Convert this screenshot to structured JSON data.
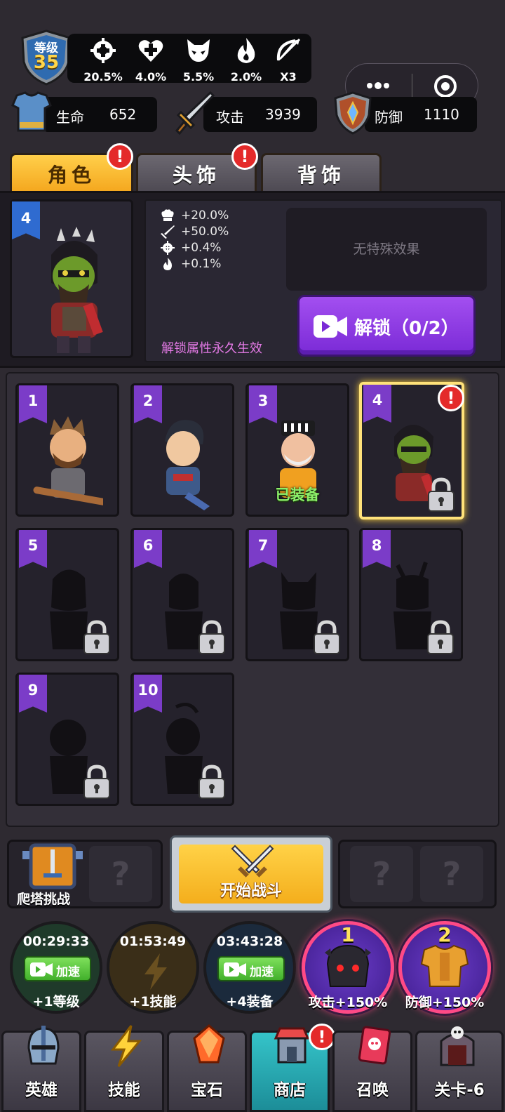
{
  "player": {
    "level_label": "等级",
    "level": "35"
  },
  "stats": [
    {
      "icon": "crosshair-icon",
      "value": "20.5%"
    },
    {
      "icon": "heart-plus-icon",
      "value": "4.0%"
    },
    {
      "icon": "beast-skull-icon",
      "value": "5.5%"
    },
    {
      "icon": "flame-icon",
      "value": "2.0%"
    },
    {
      "icon": "bow-icon",
      "value": "X3"
    }
  ],
  "resources": {
    "life_label": "生命",
    "life": "652",
    "attack_label": "攻击",
    "attack": "3939",
    "defense_label": "防御",
    "defense": "1110"
  },
  "tabs": [
    {
      "label": "角色",
      "active": true,
      "alert": "!"
    },
    {
      "label": "头饰",
      "active": false,
      "alert": "!"
    },
    {
      "label": "背饰",
      "active": false
    }
  ],
  "detail": {
    "slot_number": "4",
    "attributes": [
      {
        "icon": "chef-hat-icon",
        "text": "+20.0%"
      },
      {
        "icon": "sword-icon",
        "text": "+50.0%"
      },
      {
        "icon": "crosshair-icon",
        "text": "+0.4%"
      },
      {
        "icon": "flame-icon",
        "text": "+0.1%"
      }
    ],
    "no_effect": "无特殊效果",
    "unlock_label": "解锁（0/2）",
    "unlock_note": "解锁属性永久生效"
  },
  "heroes": [
    {
      "number": "1",
      "state": "unlocked"
    },
    {
      "number": "2",
      "state": "unlocked"
    },
    {
      "number": "3",
      "state": "equipped",
      "badge": "已装备"
    },
    {
      "number": "4",
      "state": "selected-locked",
      "alert": "!"
    },
    {
      "number": "5",
      "state": "locked"
    },
    {
      "number": "6",
      "state": "locked"
    },
    {
      "number": "7",
      "state": "locked"
    },
    {
      "number": "8",
      "state": "locked"
    },
    {
      "number": "9",
      "state": "locked"
    },
    {
      "number": "10",
      "state": "locked"
    }
  ],
  "battle": {
    "tower_label": "爬塔挑战",
    "start_label": "开始战斗",
    "unknown": "?"
  },
  "timers": [
    {
      "time": "00:29:33",
      "button": "加速",
      "reward": "+1等级",
      "color": "#1f3a2a"
    },
    {
      "time": "01:53:49",
      "reward": "+1技能",
      "color": "#3a2e18"
    },
    {
      "time": "03:43:28",
      "button": "加速",
      "reward": "+4装备",
      "color": "#1b2a3c"
    }
  ],
  "buffs": [
    {
      "number": "1",
      "label": "攻击+150%"
    },
    {
      "number": "2",
      "label": "防御+150%"
    }
  ],
  "nav": [
    {
      "label": "英雄",
      "icon": "knight-helmet-icon"
    },
    {
      "label": "技能",
      "icon": "lightning-icon"
    },
    {
      "label": "宝石",
      "icon": "gem-icon"
    },
    {
      "label": "商店",
      "icon": "shop-icon",
      "active": true,
      "alert": "!"
    },
    {
      "label": "召唤",
      "icon": "summon-scroll-icon"
    },
    {
      "label": "关卡-6",
      "icon": "skull-gate-icon"
    }
  ]
}
